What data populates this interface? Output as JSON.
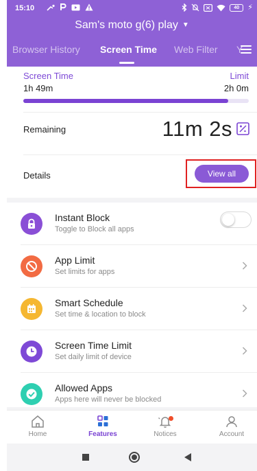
{
  "statusbar": {
    "time": "15:10",
    "battery": "40"
  },
  "header": {
    "device_name": "Sam's moto g(6) play",
    "tabs": [
      {
        "label": "Browser History",
        "active": false
      },
      {
        "label": "Screen Time",
        "active": true
      },
      {
        "label": "Web Filter",
        "active": false
      },
      {
        "label": "Y",
        "active": false
      }
    ]
  },
  "screen_time": {
    "label": "Screen Time",
    "used": "1h 49m",
    "limit_label": "Limit",
    "limit_value": "2h 0m",
    "progress_fraction": 0.91,
    "remaining_label": "Remaining",
    "remaining_value": "11m 2s",
    "details_label": "Details",
    "view_all_label": "View all"
  },
  "features": [
    {
      "title": "Instant Block",
      "subtitle": "Toggle to Block all apps",
      "icon": "lock-icon",
      "color": "#8a4fd6",
      "control": "toggle",
      "toggle_on": false
    },
    {
      "title": "App Limit",
      "subtitle": "Set limits for apps",
      "icon": "block-icon",
      "color": "#f26b43",
      "control": "chevron"
    },
    {
      "title": "Smart Schedule",
      "subtitle": "Set time & location to block",
      "icon": "calendar-icon",
      "color": "#f5b731",
      "control": "chevron"
    },
    {
      "title": "Screen Time Limit",
      "subtitle": "Set daily limit of device",
      "icon": "clock-icon",
      "color": "#7e49d6",
      "control": "chevron"
    },
    {
      "title": "Allowed Apps",
      "subtitle": "Apps here will never be blocked",
      "icon": "check-icon",
      "color": "#2ecfb1",
      "control": "chevron"
    }
  ],
  "bottom_nav": [
    {
      "label": "Home",
      "icon": "home-icon",
      "active": false
    },
    {
      "label": "Features",
      "icon": "grid-icon",
      "active": true
    },
    {
      "label": "Notices",
      "icon": "bell-icon",
      "active": false,
      "badge": true
    },
    {
      "label": "Account",
      "icon": "person-icon",
      "active": false
    }
  ],
  "colors": {
    "header_bg": "#8e61d6",
    "accent": "#7a43d3",
    "highlight_box": "#e02020"
  }
}
